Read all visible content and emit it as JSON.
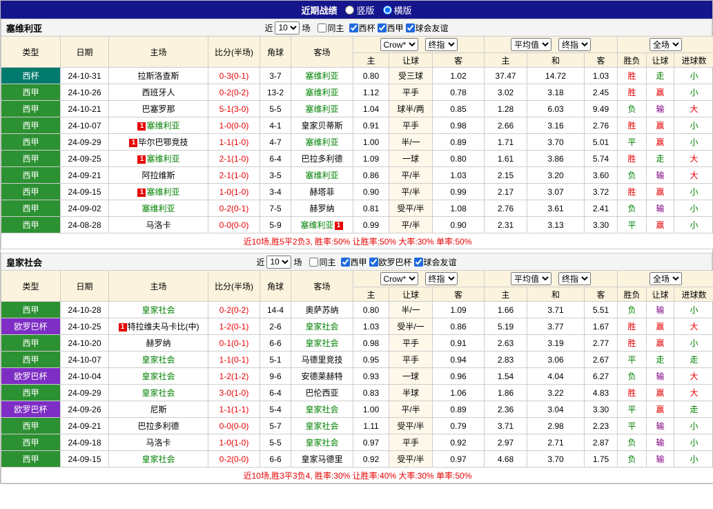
{
  "titlebar": {
    "title": "近期战绩",
    "options": [
      {
        "label": "竖版",
        "selected": false
      },
      {
        "label": "横版",
        "selected": true
      }
    ]
  },
  "controls": {
    "near_label": "近",
    "matches_label": "场",
    "same_home_label": "同主",
    "odds_source": "Crow*",
    "final_index": "终指",
    "average": "平均值",
    "full_match": "全场"
  },
  "column_headers": {
    "type": "类型",
    "date": "日期",
    "home": "主场",
    "score": "比分(半场)",
    "corner": "角球",
    "away": "客场",
    "odds_sub": [
      "主",
      "让球",
      "客"
    ],
    "avg_sub": [
      "主",
      "和",
      "客"
    ],
    "result_sub": [
      "胜负",
      "让球",
      "进球数"
    ]
  },
  "colors": {
    "topbar_bg": "#15158c",
    "header_cream": "#fbf3dd",
    "score_red": "#e60000",
    "focus_green": "#008000",
    "summary_red": "#e60000"
  },
  "comp_colors": {
    "西杯": "#007a6c",
    "西甲": "#2c9132",
    "欧罗巴杯": "#7e2ec4"
  },
  "result_colors": {
    "red": "#e60000",
    "green": "#008000",
    "purple": "#800080"
  },
  "tables": [
    {
      "team": "塞维利亚",
      "filters": {
        "count": "10",
        "same_home_checked": false,
        "competitions": [
          {
            "label": "西杯",
            "checked": true
          },
          {
            "label": "西甲",
            "checked": true
          },
          {
            "label": "球会友谊",
            "checked": true
          }
        ]
      },
      "rows": [
        {
          "comp": "西杯",
          "date": "24-10-31",
          "home": "拉斯洛查斯",
          "home_focus": false,
          "card_home": "",
          "score": "0-3(0-1)",
          "corner": "3-7",
          "away": "塞维利亚",
          "away_focus": true,
          "card_away": "",
          "odds": [
            "0.80",
            "受三球",
            "1.02"
          ],
          "avg": [
            "37.47",
            "14.72",
            "1.03"
          ],
          "results": [
            {
              "t": "胜",
              "c": "red"
            },
            {
              "t": "走",
              "c": "green"
            },
            {
              "t": "小",
              "c": "green"
            }
          ]
        },
        {
          "comp": "西甲",
          "date": "24-10-26",
          "home": "西班牙人",
          "home_focus": false,
          "card_home": "",
          "score": "0-2(0-2)",
          "corner": "13-2",
          "away": "塞维利亚",
          "away_focus": true,
          "card_away": "",
          "odds": [
            "1.12",
            "平手",
            "0.78"
          ],
          "avg": [
            "3.02",
            "3.18",
            "2.45"
          ],
          "results": [
            {
              "t": "胜",
              "c": "red"
            },
            {
              "t": "赢",
              "c": "red"
            },
            {
              "t": "小",
              "c": "green"
            }
          ]
        },
        {
          "comp": "西甲",
          "date": "24-10-21",
          "home": "巴塞罗那",
          "home_focus": false,
          "card_home": "",
          "score": "5-1(3-0)",
          "corner": "5-5",
          "away": "塞维利亚",
          "away_focus": true,
          "card_away": "",
          "odds": [
            "1.04",
            "球半/两",
            "0.85"
          ],
          "avg": [
            "1.28",
            "6.03",
            "9.49"
          ],
          "results": [
            {
              "t": "负",
              "c": "green"
            },
            {
              "t": "输",
              "c": "purple"
            },
            {
              "t": "大",
              "c": "red"
            }
          ]
        },
        {
          "comp": "西甲",
          "date": "24-10-07",
          "home": "塞维利亚",
          "home_focus": true,
          "card_home": "1",
          "score": "1-0(0-0)",
          "corner": "4-1",
          "away": "皇家贝蒂斯",
          "away_focus": false,
          "card_away": "",
          "odds": [
            "0.91",
            "平手",
            "0.98"
          ],
          "avg": [
            "2.66",
            "3.16",
            "2.76"
          ],
          "results": [
            {
              "t": "胜",
              "c": "red"
            },
            {
              "t": "赢",
              "c": "red"
            },
            {
              "t": "小",
              "c": "green"
            }
          ]
        },
        {
          "comp": "西甲",
          "date": "24-09-29",
          "home": "毕尔巴鄂竞技",
          "home_focus": false,
          "card_home": "1",
          "score": "1-1(1-0)",
          "corner": "4-7",
          "away": "塞维利亚",
          "away_focus": true,
          "card_away": "",
          "odds": [
            "1.00",
            "半/一",
            "0.89"
          ],
          "avg": [
            "1.71",
            "3.70",
            "5.01"
          ],
          "results": [
            {
              "t": "平",
              "c": "green"
            },
            {
              "t": "赢",
              "c": "red"
            },
            {
              "t": "小",
              "c": "green"
            }
          ]
        },
        {
          "comp": "西甲",
          "date": "24-09-25",
          "home": "塞维利亚",
          "home_focus": true,
          "card_home": "1",
          "score": "2-1(1-0)",
          "corner": "6-4",
          "away": "巴拉多利德",
          "away_focus": false,
          "card_away": "",
          "odds": [
            "1.09",
            "一球",
            "0.80"
          ],
          "avg": [
            "1.61",
            "3.86",
            "5.74"
          ],
          "results": [
            {
              "t": "胜",
              "c": "red"
            },
            {
              "t": "走",
              "c": "green"
            },
            {
              "t": "大",
              "c": "red"
            }
          ]
        },
        {
          "comp": "西甲",
          "date": "24-09-21",
          "home": "阿拉维斯",
          "home_focus": false,
          "card_home": "",
          "score": "2-1(1-0)",
          "corner": "3-5",
          "away": "塞维利亚",
          "away_focus": true,
          "card_away": "",
          "odds": [
            "0.86",
            "平/半",
            "1.03"
          ],
          "avg": [
            "2.15",
            "3.20",
            "3.60"
          ],
          "results": [
            {
              "t": "负",
              "c": "green"
            },
            {
              "t": "输",
              "c": "purple"
            },
            {
              "t": "大",
              "c": "red"
            }
          ]
        },
        {
          "comp": "西甲",
          "date": "24-09-15",
          "home": "塞维利亚",
          "home_focus": true,
          "card_home": "1",
          "score": "1-0(1-0)",
          "corner": "3-4",
          "away": "赫塔菲",
          "away_focus": false,
          "card_away": "",
          "odds": [
            "0.90",
            "平/半",
            "0.99"
          ],
          "avg": [
            "2.17",
            "3.07",
            "3.72"
          ],
          "results": [
            {
              "t": "胜",
              "c": "red"
            },
            {
              "t": "赢",
              "c": "red"
            },
            {
              "t": "小",
              "c": "green"
            }
          ]
        },
        {
          "comp": "西甲",
          "date": "24-09-02",
          "home": "塞维利亚",
          "home_focus": true,
          "card_home": "",
          "score": "0-2(0-1)",
          "corner": "7-5",
          "away": "赫罗纳",
          "away_focus": false,
          "card_away": "",
          "odds": [
            "0.81",
            "受平/半",
            "1.08"
          ],
          "avg": [
            "2.76",
            "3.61",
            "2.41"
          ],
          "results": [
            {
              "t": "负",
              "c": "green"
            },
            {
              "t": "输",
              "c": "purple"
            },
            {
              "t": "小",
              "c": "green"
            }
          ]
        },
        {
          "comp": "西甲",
          "date": "24-08-28",
          "home": "马洛卡",
          "home_focus": false,
          "card_home": "",
          "score": "0-0(0-0)",
          "corner": "5-9",
          "away": "塞维利亚",
          "away_focus": true,
          "card_away": "1",
          "odds": [
            "0.99",
            "平/半",
            "0.90"
          ],
          "avg": [
            "2.31",
            "3.13",
            "3.30"
          ],
          "results": [
            {
              "t": "平",
              "c": "green"
            },
            {
              "t": "赢",
              "c": "red"
            },
            {
              "t": "小",
              "c": "green"
            }
          ]
        }
      ],
      "summary": "近10场,胜5平2负3, 胜率:50% 让胜率:50% 大率:30% 单率:50%"
    },
    {
      "team": "皇家社会",
      "filters": {
        "count": "10",
        "same_home_checked": false,
        "competitions": [
          {
            "label": "西甲",
            "checked": true
          },
          {
            "label": "欧罗巴杯",
            "checked": true
          },
          {
            "label": "球会友谊",
            "checked": true
          }
        ]
      },
      "rows": [
        {
          "comp": "西甲",
          "date": "24-10-28",
          "home": "皇家社会",
          "home_focus": true,
          "card_home": "",
          "score": "0-2(0-2)",
          "corner": "14-4",
          "away": "奥萨苏纳",
          "away_focus": false,
          "card_away": "",
          "odds": [
            "0.80",
            "半/一",
            "1.09"
          ],
          "avg": [
            "1.66",
            "3.71",
            "5.51"
          ],
          "results": [
            {
              "t": "负",
              "c": "green"
            },
            {
              "t": "输",
              "c": "purple"
            },
            {
              "t": "小",
              "c": "green"
            }
          ]
        },
        {
          "comp": "欧罗巴杯",
          "date": "24-10-25",
          "home": "特拉维夫马卡比(中)",
          "home_focus": false,
          "card_home": "1",
          "score": "1-2(0-1)",
          "corner": "2-6",
          "away": "皇家社会",
          "away_focus": true,
          "card_away": "",
          "odds": [
            "1.03",
            "受半/一",
            "0.86"
          ],
          "avg": [
            "5.19",
            "3.77",
            "1.67"
          ],
          "results": [
            {
              "t": "胜",
              "c": "red"
            },
            {
              "t": "赢",
              "c": "red"
            },
            {
              "t": "大",
              "c": "red"
            }
          ]
        },
        {
          "comp": "西甲",
          "date": "24-10-20",
          "home": "赫罗纳",
          "home_focus": false,
          "card_home": "",
          "score": "0-1(0-1)",
          "corner": "6-6",
          "away": "皇家社会",
          "away_focus": true,
          "card_away": "",
          "odds": [
            "0.98",
            "平手",
            "0.91"
          ],
          "avg": [
            "2.63",
            "3.19",
            "2.77"
          ],
          "results": [
            {
              "t": "胜",
              "c": "red"
            },
            {
              "t": "赢",
              "c": "red"
            },
            {
              "t": "小",
              "c": "green"
            }
          ]
        },
        {
          "comp": "西甲",
          "date": "24-10-07",
          "home": "皇家社会",
          "home_focus": true,
          "card_home": "",
          "score": "1-1(0-1)",
          "corner": "5-1",
          "away": "马德里竞技",
          "away_focus": false,
          "card_away": "",
          "odds": [
            "0.95",
            "平手",
            "0.94"
          ],
          "avg": [
            "2.83",
            "3.06",
            "2.67"
          ],
          "results": [
            {
              "t": "平",
              "c": "green"
            },
            {
              "t": "走",
              "c": "green"
            },
            {
              "t": "走",
              "c": "green"
            }
          ]
        },
        {
          "comp": "欧罗巴杯",
          "date": "24-10-04",
          "home": "皇家社会",
          "home_focus": true,
          "card_home": "",
          "score": "1-2(1-2)",
          "corner": "9-6",
          "away": "安德莱赫特",
          "away_focus": false,
          "card_away": "",
          "odds": [
            "0.93",
            "一球",
            "0.96"
          ],
          "avg": [
            "1.54",
            "4.04",
            "6.27"
          ],
          "results": [
            {
              "t": "负",
              "c": "green"
            },
            {
              "t": "输",
              "c": "purple"
            },
            {
              "t": "大",
              "c": "red"
            }
          ]
        },
        {
          "comp": "西甲",
          "date": "24-09-29",
          "home": "皇家社会",
          "home_focus": true,
          "card_home": "",
          "score": "3-0(1-0)",
          "corner": "6-4",
          "away": "巴伦西亚",
          "away_focus": false,
          "card_away": "",
          "odds": [
            "0.83",
            "半球",
            "1.06"
          ],
          "avg": [
            "1.86",
            "3.22",
            "4.83"
          ],
          "results": [
            {
              "t": "胜",
              "c": "red"
            },
            {
              "t": "赢",
              "c": "red"
            },
            {
              "t": "大",
              "c": "red"
            }
          ]
        },
        {
          "comp": "欧罗巴杯",
          "date": "24-09-26",
          "home": "尼斯",
          "home_focus": false,
          "card_home": "",
          "score": "1-1(1-1)",
          "corner": "5-4",
          "away": "皇家社会",
          "away_focus": true,
          "card_away": "",
          "odds": [
            "1.00",
            "平/半",
            "0.89"
          ],
          "avg": [
            "2.36",
            "3.04",
            "3.30"
          ],
          "results": [
            {
              "t": "平",
              "c": "green"
            },
            {
              "t": "赢",
              "c": "red"
            },
            {
              "t": "走",
              "c": "green"
            }
          ]
        },
        {
          "comp": "西甲",
          "date": "24-09-21",
          "home": "巴拉多利德",
          "home_focus": false,
          "card_home": "",
          "score": "0-0(0-0)",
          "corner": "5-7",
          "away": "皇家社会",
          "away_focus": true,
          "card_away": "",
          "odds": [
            "1.11",
            "受平/半",
            "0.79"
          ],
          "avg": [
            "3.71",
            "2.98",
            "2.23"
          ],
          "results": [
            {
              "t": "平",
              "c": "green"
            },
            {
              "t": "输",
              "c": "purple"
            },
            {
              "t": "小",
              "c": "green"
            }
          ]
        },
        {
          "comp": "西甲",
          "date": "24-09-18",
          "home": "马洛卡",
          "home_focus": false,
          "card_home": "",
          "score": "1-0(1-0)",
          "corner": "5-5",
          "away": "皇家社会",
          "away_focus": true,
          "card_away": "",
          "odds": [
            "0.97",
            "平手",
            "0.92"
          ],
          "avg": [
            "2.97",
            "2.71",
            "2.87"
          ],
          "results": [
            {
              "t": "负",
              "c": "green"
            },
            {
              "t": "输",
              "c": "purple"
            },
            {
              "t": "小",
              "c": "green"
            }
          ]
        },
        {
          "comp": "西甲",
          "date": "24-09-15",
          "home": "皇家社会",
          "home_focus": true,
          "card_home": "",
          "score": "0-2(0-0)",
          "corner": "6-6",
          "away": "皇家马德里",
          "away_focus": false,
          "card_away": "",
          "odds": [
            "0.92",
            "受平/半",
            "0.97"
          ],
          "avg": [
            "4.68",
            "3.70",
            "1.75"
          ],
          "results": [
            {
              "t": "负",
              "c": "green"
            },
            {
              "t": "输",
              "c": "purple"
            },
            {
              "t": "小",
              "c": "green"
            }
          ]
        }
      ],
      "summary": "近10场,胜3平3负4, 胜率:30% 让胜率:40% 大率:30% 单率:50%"
    }
  ]
}
